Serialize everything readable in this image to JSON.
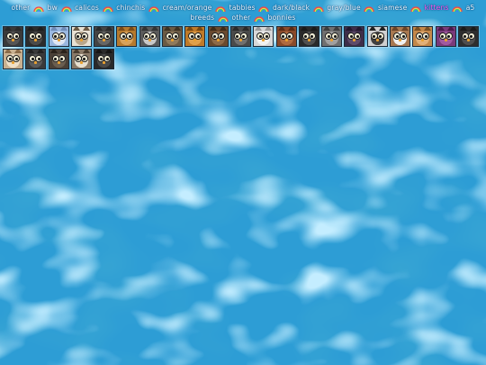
{
  "nav": {
    "links": [
      {
        "label": "other",
        "active": false
      },
      {
        "label": "bw",
        "active": false
      },
      {
        "label": "calicos",
        "active": false
      },
      {
        "label": "chinchis",
        "active": false
      },
      {
        "label": "cream/orange",
        "active": false
      },
      {
        "label": "tabbies",
        "active": false
      },
      {
        "label": "dark/black",
        "active": false
      },
      {
        "label": "gray/blue",
        "active": false
      },
      {
        "label": "siamese",
        "active": false
      },
      {
        "label": "kittens",
        "active": true
      },
      {
        "label": "a5 breeds",
        "active": false
      },
      {
        "label": "other",
        "active": false
      },
      {
        "label": "bonnies",
        "active": false
      }
    ],
    "separator_icon": "rainbow-icon",
    "active_color": "#ff55ee"
  },
  "pets": [
    {
      "name": "pet-1",
      "fur": "#3a3a3a",
      "face": "#555555",
      "ear": "#2a2a2a"
    },
    {
      "name": "pet-2",
      "fur": "#2c2c2c",
      "face": "#4a4a4a",
      "ear": "#1e1e1e"
    },
    {
      "name": "pet-3",
      "fur": "#9ab8e0",
      "face": "#dfe6f2",
      "ear": "#6f8cb8"
    },
    {
      "name": "pet-4",
      "fur": "#e8e2d4",
      "face": "#b9a78c",
      "ear": "#6d5a44"
    },
    {
      "name": "pet-5",
      "fur": "#444444",
      "face": "#666666",
      "ear": "#2a2a2a"
    },
    {
      "name": "pet-6",
      "fur": "#b67a2e",
      "face": "#d9a25a",
      "ear": "#7a4a18"
    },
    {
      "name": "pet-7",
      "fur": "#5a5a5a",
      "face": "#c8c8c8",
      "ear": "#333333"
    },
    {
      "name": "pet-8",
      "fur": "#6b5a44",
      "face": "#8f7a5c",
      "ear": "#3e3222"
    },
    {
      "name": "pet-9",
      "fur": "#c07a28",
      "face": "#e0a04a",
      "ear": "#7a4810"
    },
    {
      "name": "pet-10",
      "fur": "#6a4a2e",
      "face": "#8d6a48",
      "ear": "#3e2a18"
    },
    {
      "name": "pet-11",
      "fur": "#4a4a4a",
      "face": "#707070",
      "ear": "#2a2a2a"
    },
    {
      "name": "pet-12",
      "fur": "#d8d8d8",
      "face": "#f2f2f2",
      "ear": "#9a9a9a"
    },
    {
      "name": "pet-13",
      "fur": "#8a4a2a",
      "face": "#b06a40",
      "ear": "#5a2a14"
    },
    {
      "name": "pet-14",
      "fur": "#2a2a2a",
      "face": "#505050",
      "ear": "#1a1a1a"
    },
    {
      "name": "pet-15",
      "fur": "#707070",
      "face": "#a0a0a0",
      "ear": "#3e3e3e"
    },
    {
      "name": "pet-16",
      "fur": "#3e2e4a",
      "face": "#5e4a6a",
      "ear": "#24182e"
    },
    {
      "name": "pet-17",
      "fur": "#d0d0d0",
      "face": "#404040",
      "ear": "#222222"
    },
    {
      "name": "pet-18",
      "fur": "#a87850",
      "face": "#f0f0f0",
      "ear": "#6a4428"
    },
    {
      "name": "pet-19",
      "fur": "#c4884a",
      "face": "#e2b078",
      "ear": "#7a5024"
    },
    {
      "name": "pet-20",
      "fur": "#7a3a7a",
      "face": "#a05aa0",
      "ear": "#4a1a4a"
    },
    {
      "name": "pet-21",
      "fur": "#2e2e2e",
      "face": "#4e4e4e",
      "ear": "#1a1a1a"
    },
    {
      "name": "pet-22",
      "fur": "#c8b090",
      "face": "#f0e0c8",
      "ear": "#8a6a48"
    },
    {
      "name": "pet-23",
      "fur": "#3a3a3a",
      "face": "#5a5a5a",
      "ear": "#222222"
    },
    {
      "name": "pet-24",
      "fur": "#4a4036",
      "face": "#6a5e50",
      "ear": "#2a221a"
    },
    {
      "name": "pet-25",
      "fur": "#8a7a68",
      "face": "#e8e0d0",
      "ear": "#4a3e30"
    },
    {
      "name": "pet-26",
      "fur": "#2a2a2a",
      "face": "#4a4a4a",
      "ear": "#151515"
    }
  ]
}
